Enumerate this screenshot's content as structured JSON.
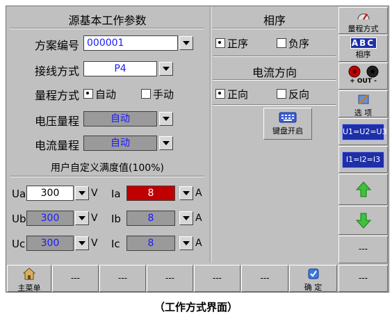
{
  "left_panel": {
    "title": "源基本工作参数",
    "scheme_label": "方案编号",
    "scheme_value": "000001",
    "wiring_label": "接线方式",
    "wiring_value": "P4",
    "range_mode_label": "量程方式",
    "range_auto": "自动",
    "range_manual": "手动",
    "voltage_range_label": "电压量程",
    "voltage_range_value": "自动",
    "current_range_label": "电流量程",
    "current_range_value": "自动",
    "fullscale_title": "用户自定义满度值(100%)",
    "rows": [
      {
        "v_label": "Ua",
        "v_value": "300",
        "v_unit": "V",
        "i_label": "Ia",
        "i_value": "8",
        "i_unit": "A"
      },
      {
        "v_label": "Ub",
        "v_value": "300",
        "v_unit": "V",
        "i_label": "Ib",
        "i_value": "8",
        "i_unit": "A"
      },
      {
        "v_label": "Uc",
        "v_value": "300",
        "v_unit": "V",
        "i_label": "Ic",
        "i_value": "8",
        "i_unit": "A"
      }
    ]
  },
  "phase_panel": {
    "title": "相序",
    "positive": "正序",
    "negative": "负序",
    "selected": "positive"
  },
  "direction_panel": {
    "title": "电流方向",
    "forward": "正向",
    "reverse": "反向",
    "selected": "forward"
  },
  "keyboard_button": {
    "label": "键盘开启"
  },
  "sidebar": {
    "range_mode": "量程方式",
    "abc_text": "ABC",
    "phase_seq": "相序",
    "out_text": "+ OUT -",
    "options": "选 项",
    "u_equal": "U1=U2=U3",
    "i_equal": "I1=I2=I3",
    "blank": "---"
  },
  "bottom_bar": {
    "main_menu": "主菜单",
    "blank": "---",
    "confirm": "确 定"
  },
  "caption": "（工作方式界面）",
  "colors": {
    "panel": "#c0c0c0",
    "value_text": "#1a1aff",
    "red_field": "#c00000",
    "grey_field": "#9a9a9a",
    "sidebar_blue": "#1e2fa8"
  }
}
